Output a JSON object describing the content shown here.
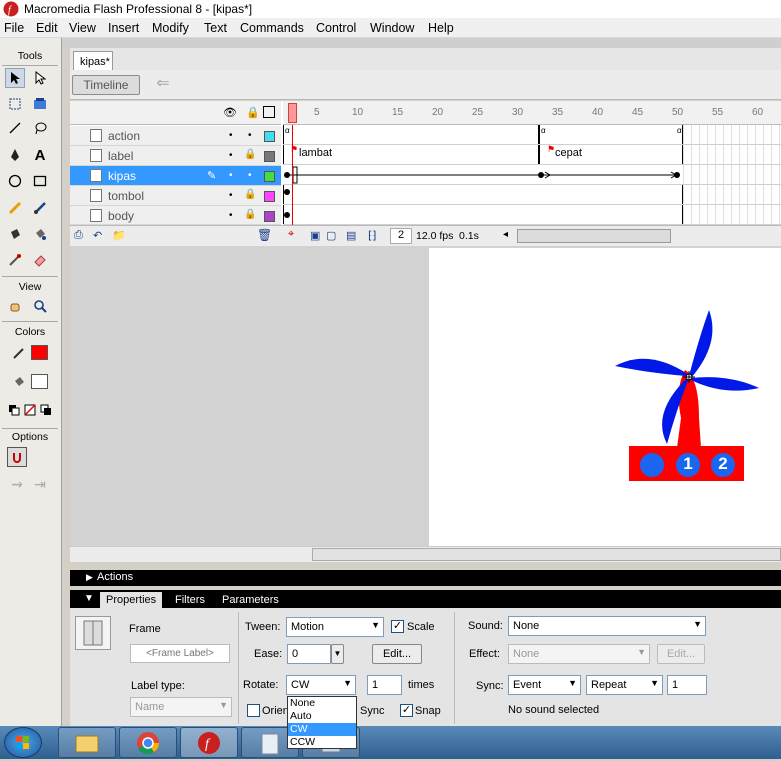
{
  "window": {
    "title": "Macromedia Flash Professional 8 - [kipas*]"
  },
  "menu": [
    "File",
    "Edit",
    "View",
    "Insert",
    "Modify",
    "Text",
    "Commands",
    "Control",
    "Window",
    "Help"
  ],
  "tools": {
    "tools_label": "Tools",
    "view_label": "View",
    "colors_label": "Colors",
    "options_label": "Options",
    "stroke_color": "#ff0000",
    "fill_color": "#ffffff"
  },
  "document": {
    "tab_label": "kipas*"
  },
  "timeline": {
    "button_label": "Timeline",
    "ruler": [
      "5",
      "10",
      "15",
      "20",
      "25",
      "30",
      "35",
      "40",
      "45",
      "50",
      "55",
      "60"
    ],
    "layers": [
      {
        "name": "action",
        "color": "#44ddee",
        "selected": false
      },
      {
        "name": "label",
        "color": "#777777",
        "selected": false
      },
      {
        "name": "kipas",
        "color": "#44dd44",
        "selected": true
      },
      {
        "name": "tombol",
        "color": "#ff44ff",
        "selected": false
      },
      {
        "name": "body",
        "color": "#aa44cc",
        "selected": false
      }
    ],
    "frame_labels": {
      "first": "lambat",
      "second": "cepat"
    },
    "current_frame": "2",
    "fps": "12.0 fps",
    "elapsed": "0.1s"
  },
  "stage": {
    "buttons": [
      "1",
      "2"
    ]
  },
  "panels": {
    "actions_label": "Actions",
    "tabs": [
      "Properties",
      "Filters",
      "Parameters"
    ]
  },
  "properties": {
    "frame_label": "Frame",
    "frame_label_placeholder": "<Frame Label>",
    "tween_label": "Tween:",
    "tween_value": "Motion",
    "scale_label": "Scale",
    "ease_label": "Ease:",
    "ease_value": "0",
    "edit_label": "Edit...",
    "label_type_label": "Label type:",
    "label_type_value": "Name",
    "rotate_label": "Rotate:",
    "rotate_value": "CW",
    "times_value": "1",
    "times_label": "times",
    "orient_label": "Orien",
    "sync_label": "Sync",
    "snap_label": "Snap",
    "sound_label": "Sound:",
    "sound_value": "None",
    "effect_label": "Effect:",
    "effect_value": "None",
    "effect_edit_label": "Edit...",
    "sync2_label": "Sync:",
    "sync_event": "Event",
    "sync_repeat": "Repeat",
    "repeat_count": "1",
    "no_sound": "No sound selected"
  },
  "rotate_dropdown": {
    "options": [
      "None",
      "Auto",
      "CW",
      "CCW"
    ],
    "selected": "CW"
  }
}
